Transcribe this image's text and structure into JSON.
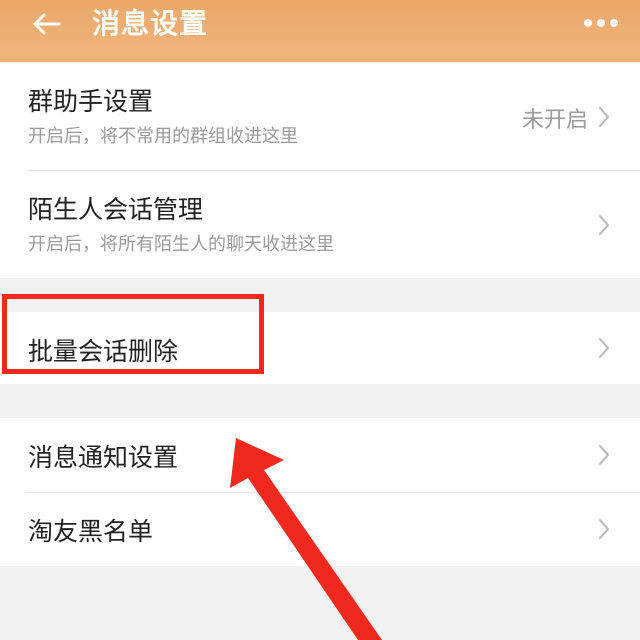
{
  "header": {
    "title": "消息设置",
    "accent": "#eaa86a"
  },
  "sections": [
    {
      "rows": [
        {
          "title": "群助手设置",
          "subtitle": "开启后，将不常用的群组收进这里",
          "value": "未开启"
        },
        {
          "title": "陌生人会话管理",
          "subtitle": "开启后，将所有陌生人的聊天收进这里"
        }
      ]
    },
    {
      "rows": [
        {
          "title": "批量会话删除"
        }
      ]
    },
    {
      "rows": [
        {
          "title": "消息通知设置"
        },
        {
          "title": "淘友黑名单"
        }
      ]
    }
  ],
  "annotation": {
    "highlight_color": "#f0281e",
    "icons": [
      "arrow-left-icon",
      "more-dots-icon",
      "chevron-right-icon"
    ]
  }
}
